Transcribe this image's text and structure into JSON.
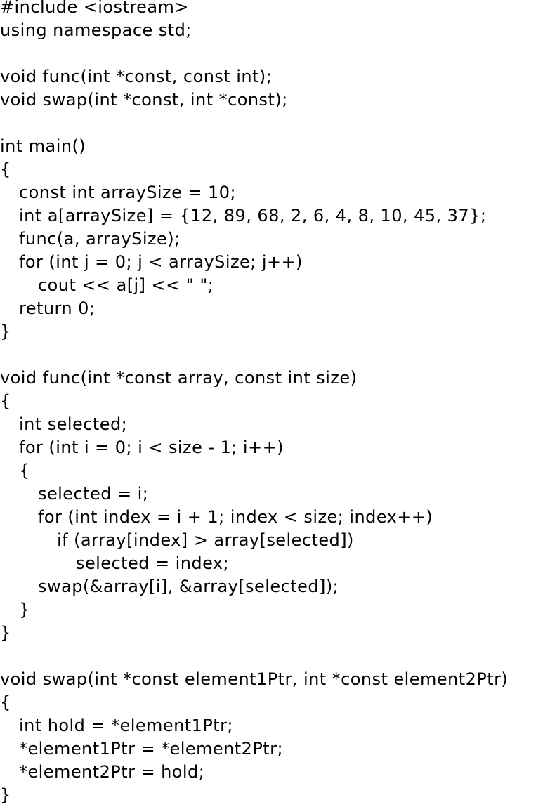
{
  "code_lines": [
    {
      "indent": 0,
      "text": "#include <iostream>"
    },
    {
      "indent": 0,
      "text": "using namespace std;"
    },
    {
      "indent": 0,
      "text": ""
    },
    {
      "indent": 0,
      "text": "void func(int *const, const int);"
    },
    {
      "indent": 0,
      "text": "void swap(int *const, int *const);"
    },
    {
      "indent": 0,
      "text": ""
    },
    {
      "indent": 0,
      "text": "int main()"
    },
    {
      "indent": 0,
      "text": "{"
    },
    {
      "indent": 1,
      "text": "const int arraySize = 10;"
    },
    {
      "indent": 1,
      "text": "int a[arraySize] = {12, 89, 68, 2, 6, 4, 8, 10, 45, 37};"
    },
    {
      "indent": 1,
      "text": "func(a, arraySize);"
    },
    {
      "indent": 1,
      "text": "for (int j = 0; j < arraySize; j++)"
    },
    {
      "indent": 2,
      "text": "cout << a[j] << \" \";"
    },
    {
      "indent": 1,
      "text": "return 0;"
    },
    {
      "indent": 0,
      "text": "}"
    },
    {
      "indent": 0,
      "text": ""
    },
    {
      "indent": 0,
      "text": "void func(int *const array, const int size)"
    },
    {
      "indent": 0,
      "text": "{"
    },
    {
      "indent": 1,
      "text": "int selected;"
    },
    {
      "indent": 1,
      "text": "for (int i = 0; i < size - 1; i++)"
    },
    {
      "indent": 1,
      "text": "{"
    },
    {
      "indent": 2,
      "text": "selected = i;"
    },
    {
      "indent": 2,
      "text": "for (int index = i + 1; index < size; index++)"
    },
    {
      "indent": 3,
      "text": "if (array[index] > array[selected])"
    },
    {
      "indent": 4,
      "text": "selected = index;"
    },
    {
      "indent": 2,
      "text": "swap(&array[i], &array[selected]);"
    },
    {
      "indent": 1,
      "text": "}"
    },
    {
      "indent": 0,
      "text": "}"
    },
    {
      "indent": 0,
      "text": ""
    },
    {
      "indent": 0,
      "text": "void swap(int *const element1Ptr, int *const element2Ptr)"
    },
    {
      "indent": 0,
      "text": "{"
    },
    {
      "indent": 1,
      "text": "int hold = *element1Ptr;"
    },
    {
      "indent": 1,
      "text": "*element1Ptr = *element2Ptr;"
    },
    {
      "indent": 1,
      "text": "*element2Ptr = hold;"
    },
    {
      "indent": 0,
      "text": "}"
    }
  ]
}
